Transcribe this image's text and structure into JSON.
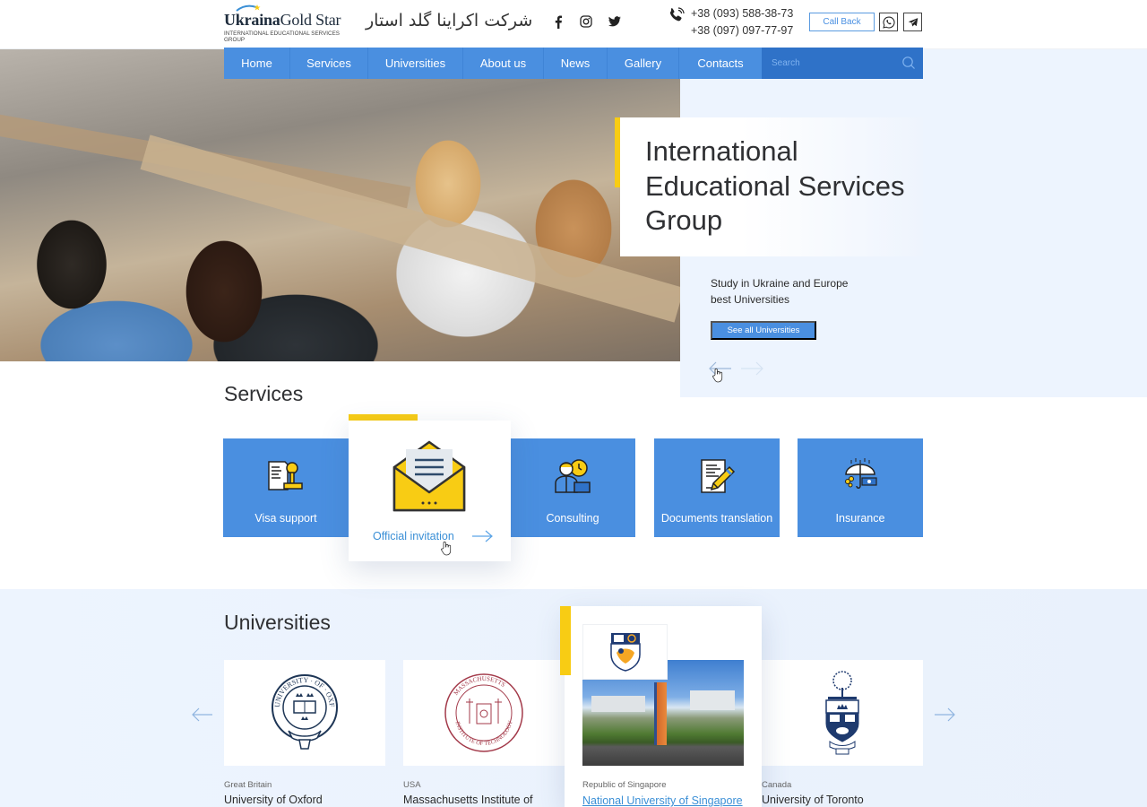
{
  "header": {
    "logo": {
      "bold": "Ukraina",
      "regular1": "Gold",
      "regular2": " Star",
      "subtitle": "International Educational Services Group"
    },
    "farsi_name": "شرکت اکراینا گلد استار",
    "social": [
      "facebook",
      "instagram",
      "twitter"
    ],
    "phones": [
      "+38 (093) 588-38-73",
      "+38 (097) 097-77-97"
    ],
    "call_back_label": "Call Back",
    "messengers": [
      "whatsapp",
      "telegram"
    ]
  },
  "nav": {
    "items": [
      {
        "label": "Home"
      },
      {
        "label": "Services"
      },
      {
        "label": "Universities"
      },
      {
        "label": "About us"
      },
      {
        "label": "News"
      },
      {
        "label": "Gallery"
      },
      {
        "label": "Contacts"
      }
    ],
    "search_placeholder": "Search"
  },
  "hero": {
    "title": "International Educational Services Group",
    "subtitle_line1": "Study in Ukraine and Europe",
    "subtitle_line2": "best Universities",
    "button_label": "See all Universities"
  },
  "services": {
    "title": "Services",
    "items": [
      {
        "label": "Visa support",
        "icon": "stamp-document-icon"
      },
      {
        "label": "Official invitation",
        "icon": "envelope-letter-icon",
        "active": true
      },
      {
        "label": "Consulting",
        "icon": "consultant-clock-icon"
      },
      {
        "label": "Documents translation",
        "icon": "document-pen-icon"
      },
      {
        "label": "Insurance",
        "icon": "umbrella-money-icon"
      }
    ]
  },
  "universities": {
    "title": "Universities",
    "items": [
      {
        "country": "Great Britain",
        "name": "University of Oxford"
      },
      {
        "country": "USA",
        "name": "Massachusetts Institute of"
      },
      {
        "country": "Republic of Singapore",
        "name": "National University of Singapore",
        "active": true
      },
      {
        "country": "Canada",
        "name": "University of Toronto"
      }
    ]
  },
  "colors": {
    "primary": "#4a8fe0",
    "primary_dark": "#2f72c8",
    "accent": "#f8cc14",
    "link": "#3a8fd6",
    "bg_light": "#edf4fe"
  }
}
